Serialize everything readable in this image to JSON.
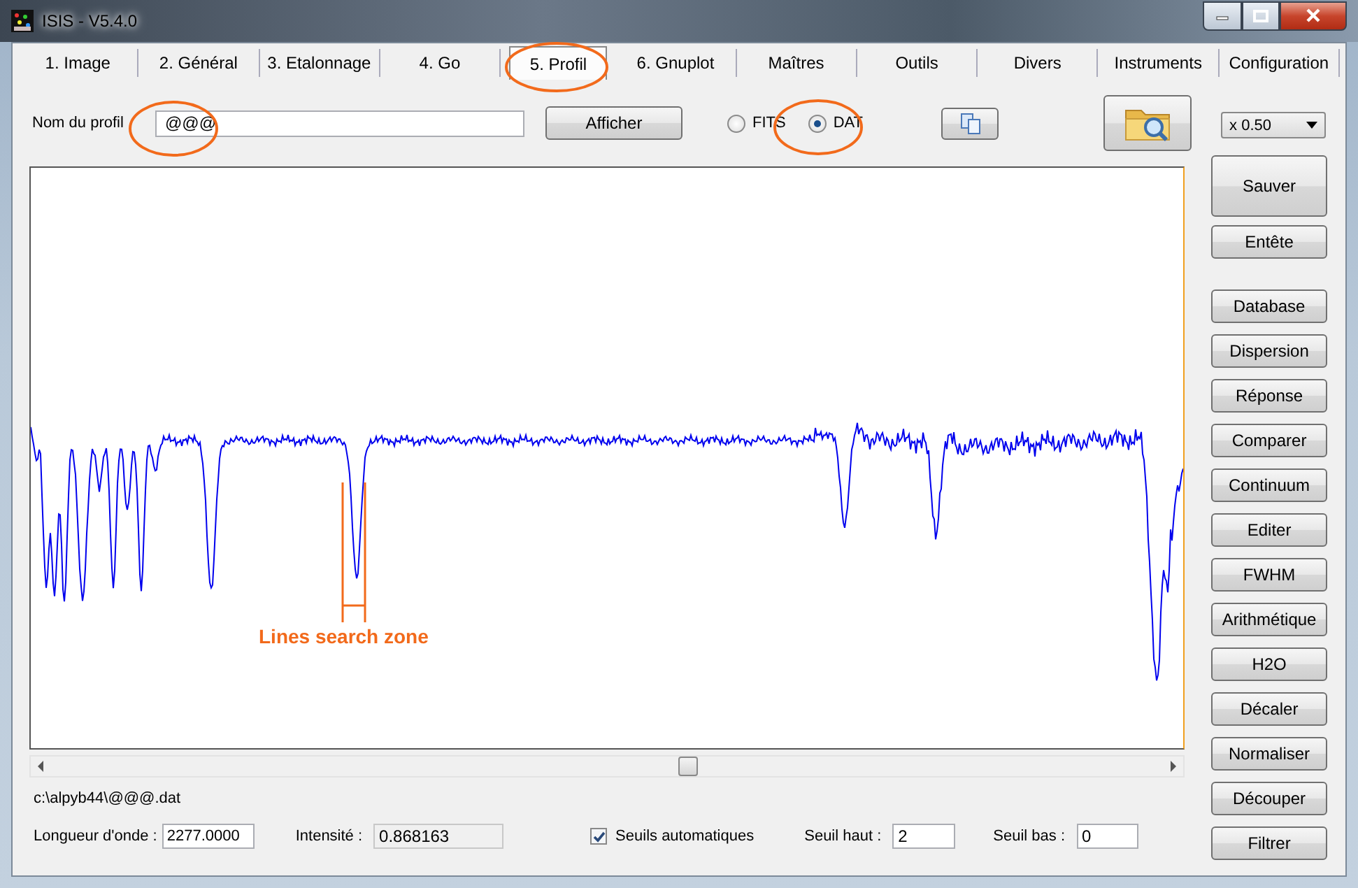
{
  "window": {
    "title": "ISIS - V5.4.0"
  },
  "tabs": [
    {
      "label": "1. Image",
      "selected": false
    },
    {
      "label": "2. Général",
      "selected": false
    },
    {
      "label": "3. Etalonnage",
      "selected": false
    },
    {
      "label": "4. Go",
      "selected": false
    },
    {
      "label": "5. Profil",
      "selected": true
    },
    {
      "label": "6. Gnuplot",
      "selected": false
    },
    {
      "label": "Maîtres",
      "selected": false
    },
    {
      "label": "Outils",
      "selected": false
    },
    {
      "label": "Divers",
      "selected": false
    },
    {
      "label": "Instruments",
      "selected": false
    },
    {
      "label": "Configuration",
      "selected": false
    }
  ],
  "profile": {
    "label": "Nom du profil",
    "value": "@@@",
    "show_button": "Afficher",
    "formats": [
      {
        "label": "FITS",
        "selected": false
      },
      {
        "label": "DAT",
        "selected": true
      }
    ],
    "zoom": "x 0.50"
  },
  "plot": {
    "annotation": "Lines search zone"
  },
  "file_path": "c:\\alpyb44\\@@@.dat",
  "wavelength": {
    "label": "Longueur d'onde :",
    "value": "2277.0000"
  },
  "intensity": {
    "label": "Intensité :",
    "value": "0.868163"
  },
  "auto_thresholds": {
    "label": "Seuils automatiques",
    "checked": true
  },
  "high_threshold": {
    "label": "Seuil haut :",
    "value": "2"
  },
  "low_threshold": {
    "label": "Seuil bas :",
    "value": "0"
  },
  "side_buttons": [
    "Sauver",
    "Entête",
    "Database",
    "Dispersion",
    "Réponse",
    "Comparer",
    "Continuum",
    "Editer",
    "FWHM",
    "Arithmétique",
    "H2O",
    "Décaler",
    "Normaliser",
    "Découper",
    "Filtrer"
  ]
}
